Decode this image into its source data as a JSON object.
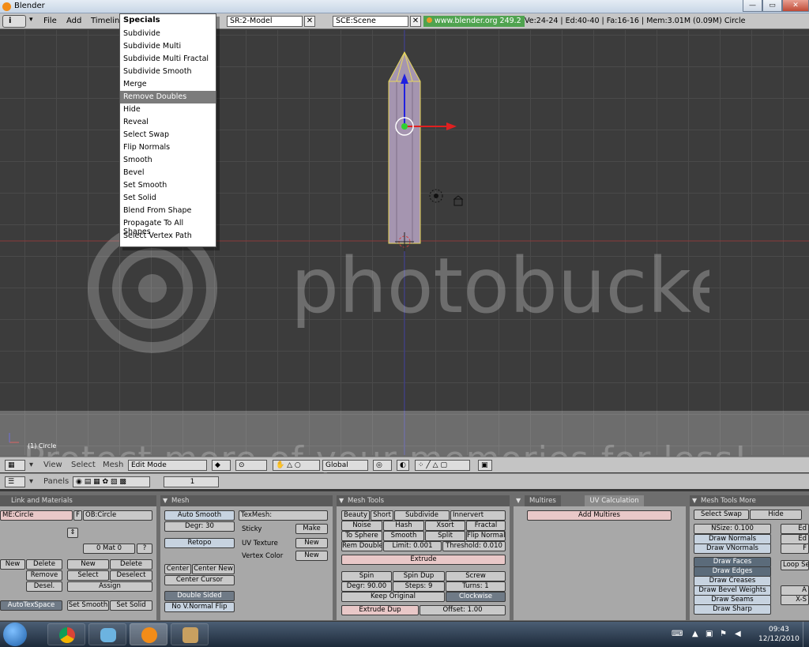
{
  "window": {
    "title": "Blender",
    "min_label": "—",
    "max_label": "▭",
    "close_label": "✕"
  },
  "menubar": {
    "menus": [
      "File",
      "Add",
      "Timeline"
    ],
    "screen_field": "SR:2-Model",
    "scene_field": "SCE:Scene",
    "info_text": "www.blender.org 249.2",
    "stats": "Ve:24-24 | Ed:40-40 | Fa:16-16 | Mem:3.01M (0.09M) Circle"
  },
  "specials_menu": {
    "title": "Specials",
    "items": [
      "Subdivide",
      "Subdivide Multi",
      "Subdivide Multi Fractal",
      "Subdivide Smooth",
      "Merge",
      "Remove Doubles",
      "Hide",
      "Reveal",
      "Select Swap",
      "Flip Normals",
      "Smooth",
      "Bevel",
      "Set Smooth",
      "Set Solid",
      "Blend From Shape",
      "Propagate To All Shapes",
      "Select Vertex Path"
    ],
    "highlighted": "Remove Doubles"
  },
  "viewport": {
    "object_label": "(1) Circle"
  },
  "watermark": {
    "logo_text": "photobucket",
    "tagline": "Protect more of your memories for less!"
  },
  "view3d_header": {
    "menus": [
      "View",
      "Select",
      "Mesh"
    ],
    "mode": "Edit Mode",
    "orientation": "Global"
  },
  "buttons_header": {
    "panels_label": "Panels",
    "frame": "1"
  },
  "panels": {
    "link_materials": {
      "title": "Link and Materials",
      "mesh_name": "ME:Circle",
      "f_label": "F",
      "ob_name": "OB:Circle",
      "mat_label": "0 Mat 0",
      "question": "?",
      "new1": "New",
      "delete1": "Delete",
      "remove": "Remove",
      "desel": "Desel.",
      "new2": "New",
      "delete2": "Delete",
      "select": "Select",
      "deselect": "Deselect",
      "assign": "Assign",
      "autotex": "AutoTexSpace",
      "set_smooth": "Set Smooth",
      "set_solid": "Set Solid"
    },
    "mesh": {
      "title": "Mesh",
      "auto_smooth": "Auto Smooth",
      "degr": "Degr: 30",
      "retopo": "Retopo",
      "texmesh": "TexMesh:",
      "sticky": "Sticky",
      "make": "Make",
      "uv_texture": "UV Texture",
      "vertex_color": "Vertex Color",
      "new": "New",
      "center": "Center",
      "center_new": "Center New",
      "center_cursor": "Center Cursor",
      "double_sided": "Double Sided",
      "no_vnormal_flip": "No V.Normal Flip"
    },
    "mesh_tools": {
      "title": "Mesh Tools",
      "beauty": "Beauty",
      "short": "Short",
      "subdivide": "Subdivide",
      "innervert": "Innervert",
      "noise": "Noise",
      "hash": "Hash",
      "xsort": "Xsort",
      "fractal": "Fractal",
      "to_sphere": "To Sphere",
      "smooth": "Smooth",
      "split": "Split",
      "flip_normals": "Flip Normals",
      "rem_doubles": "Rem Doubles",
      "limit": "Limit: 0.001",
      "threshold": "Threshold: 0.010",
      "extrude": "Extrude",
      "spin": "Spin",
      "spin_dup": "Spin Dup",
      "screw": "Screw",
      "degr": "Degr: 90.00",
      "steps": "Steps: 9",
      "turns": "Turns: 1",
      "keep_original": "Keep Original",
      "clockwise": "Clockwise",
      "extrude_dup": "Extrude Dup",
      "offset": "Offset: 1.00"
    },
    "multires": {
      "tab1": "Multires",
      "tab2": "UV Calculation",
      "add_multires": "Add Multires"
    },
    "mesh_tools_more": {
      "title": "Mesh Tools More",
      "select_swap": "Select Swap",
      "hide": "Hide",
      "nsize": "NSize: 0.100",
      "draw_normals": "Draw Normals",
      "draw_vnormals": "Draw VNormals",
      "draw_faces": "Draw Faces",
      "draw_edges": "Draw Edges",
      "draw_creases": "Draw Creases",
      "draw_bevel": "Draw Bevel Weights",
      "draw_seams": "Draw Seams",
      "draw_sharp": "Draw Sharp",
      "loop_sel": "Loop Sel",
      "ed1": "Ed",
      "ed2": "Ed",
      "f": "F",
      "a": "A",
      "xs": "X-S"
    }
  },
  "taskbar": {
    "time": "09:43",
    "date": "12/12/2010"
  }
}
